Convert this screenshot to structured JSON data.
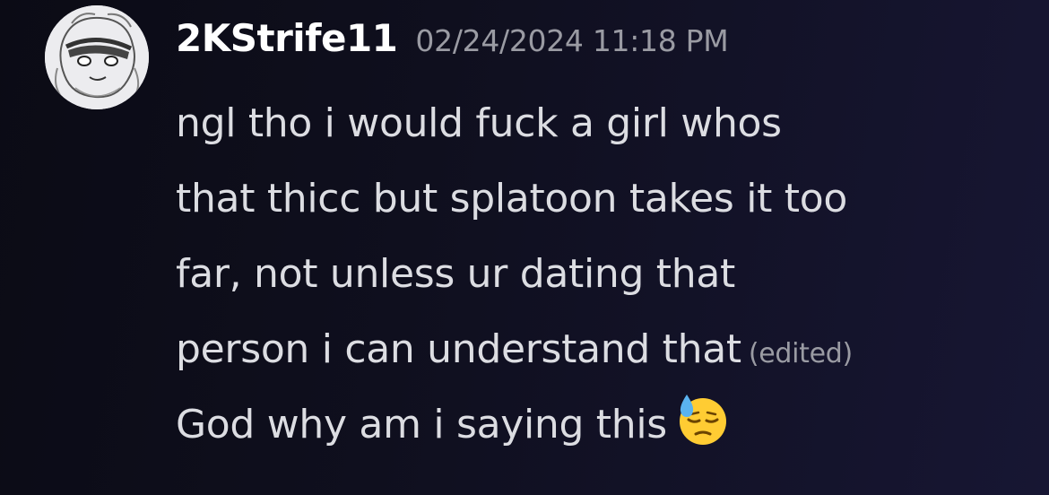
{
  "author": {
    "username": "2KStrife11",
    "avatar_icon": "sketch-character-avatar"
  },
  "timestamp": "02/24/2024 11:18 PM",
  "message": {
    "lines": [
      "ngl tho i would fuck a girl whos",
      "that thicc but splatoon takes it too",
      "far, not unless ur dating that",
      "person i can understand that"
    ],
    "edited_label": "(edited)",
    "followup": "God why am i saying this",
    "emoji": "downcast-face-with-sweat"
  },
  "colors": {
    "username": "#ffffff",
    "text": "#dcdde2",
    "muted": "#9a9ba3",
    "background": "#0f0f1e"
  }
}
